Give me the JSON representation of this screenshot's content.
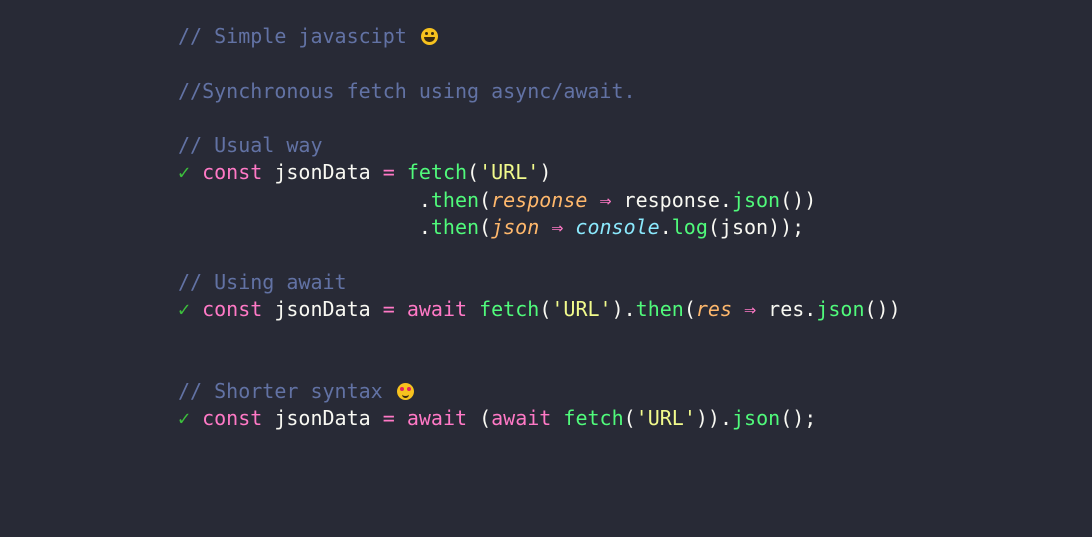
{
  "colors": {
    "background": "#282a36",
    "comment": "#6272a4",
    "keyword": "#ff79c6",
    "function": "#50fa7b",
    "string": "#f1fa8c",
    "parameter": "#ffb86c",
    "builtin": "#8be9fd",
    "text": "#f8f8f2",
    "check": "#3cc03c"
  },
  "code": {
    "lines": [
      [
        {
          "t": "comment",
          "v": "// Simple javascipt "
        },
        {
          "t": "emoji",
          "v": "grinning-face-emoji"
        }
      ],
      [],
      [
        {
          "t": "comment",
          "v": "//Synchronous fetch using async/await."
        }
      ],
      [],
      [
        {
          "t": "comment",
          "v": "// Usual way"
        }
      ],
      [
        {
          "t": "check",
          "v": "✓"
        },
        {
          "t": "plain",
          "v": " "
        },
        {
          "t": "keyword",
          "v": "const"
        },
        {
          "t": "plain",
          "v": " jsonData "
        },
        {
          "t": "keyword",
          "v": "="
        },
        {
          "t": "plain",
          "v": " "
        },
        {
          "t": "func",
          "v": "fetch"
        },
        {
          "t": "plain",
          "v": "("
        },
        {
          "t": "string",
          "v": "'URL'"
        },
        {
          "t": "plain",
          "v": ")"
        }
      ],
      [
        {
          "t": "plain",
          "v": "                    ."
        },
        {
          "t": "func",
          "v": "then"
        },
        {
          "t": "plain",
          "v": "("
        },
        {
          "t": "param",
          "v": "response"
        },
        {
          "t": "plain",
          "v": " "
        },
        {
          "t": "arrow",
          "v": "⇒"
        },
        {
          "t": "plain",
          "v": " response."
        },
        {
          "t": "func",
          "v": "json"
        },
        {
          "t": "plain",
          "v": "())"
        }
      ],
      [
        {
          "t": "plain",
          "v": "                    ."
        },
        {
          "t": "func",
          "v": "then"
        },
        {
          "t": "plain",
          "v": "("
        },
        {
          "t": "param",
          "v": "json"
        },
        {
          "t": "plain",
          "v": " "
        },
        {
          "t": "arrow",
          "v": "⇒"
        },
        {
          "t": "plain",
          "v": " "
        },
        {
          "t": "builtin",
          "v": "console"
        },
        {
          "t": "plain",
          "v": "."
        },
        {
          "t": "func",
          "v": "log"
        },
        {
          "t": "plain",
          "v": "(json));"
        }
      ],
      [],
      [
        {
          "t": "comment",
          "v": "// Using await"
        }
      ],
      [
        {
          "t": "check",
          "v": "✓"
        },
        {
          "t": "plain",
          "v": " "
        },
        {
          "t": "keyword",
          "v": "const"
        },
        {
          "t": "plain",
          "v": " jsonData "
        },
        {
          "t": "keyword",
          "v": "="
        },
        {
          "t": "plain",
          "v": " "
        },
        {
          "t": "keyword",
          "v": "await"
        },
        {
          "t": "plain",
          "v": " "
        },
        {
          "t": "func",
          "v": "fetch"
        },
        {
          "t": "plain",
          "v": "("
        },
        {
          "t": "string",
          "v": "'URL'"
        },
        {
          "t": "plain",
          "v": ")."
        },
        {
          "t": "func",
          "v": "then"
        },
        {
          "t": "plain",
          "v": "("
        },
        {
          "t": "param",
          "v": "res"
        },
        {
          "t": "plain",
          "v": " "
        },
        {
          "t": "arrow",
          "v": "⇒"
        },
        {
          "t": "plain",
          "v": " res."
        },
        {
          "t": "func",
          "v": "json"
        },
        {
          "t": "plain",
          "v": "())"
        }
      ],
      [],
      [],
      [
        {
          "t": "comment",
          "v": "// Shorter syntax "
        },
        {
          "t": "emoji",
          "v": "heart-eyes-emoji"
        }
      ],
      [
        {
          "t": "check",
          "v": "✓"
        },
        {
          "t": "plain",
          "v": " "
        },
        {
          "t": "keyword",
          "v": "const"
        },
        {
          "t": "plain",
          "v": " jsonData "
        },
        {
          "t": "keyword",
          "v": "="
        },
        {
          "t": "plain",
          "v": " "
        },
        {
          "t": "keyword",
          "v": "await"
        },
        {
          "t": "plain",
          "v": " ("
        },
        {
          "t": "keyword",
          "v": "await"
        },
        {
          "t": "plain",
          "v": " "
        },
        {
          "t": "func",
          "v": "fetch"
        },
        {
          "t": "plain",
          "v": "("
        },
        {
          "t": "string",
          "v": "'URL'"
        },
        {
          "t": "plain",
          "v": "))."
        },
        {
          "t": "func",
          "v": "json"
        },
        {
          "t": "plain",
          "v": "();"
        }
      ]
    ]
  }
}
